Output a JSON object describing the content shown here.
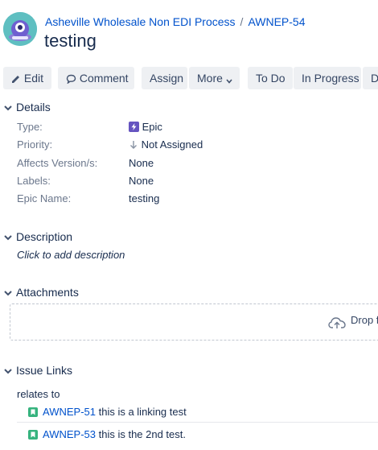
{
  "breadcrumb": {
    "project": "Asheville Wholesale Non EDI Process",
    "separator": "/",
    "issue_key": "AWNEP-54"
  },
  "title": "testing",
  "toolbar": {
    "edit": "Edit",
    "comment": "Comment",
    "assign": "Assign",
    "more": "More",
    "todo": "To Do",
    "in_progress": "In Progress",
    "done": "D"
  },
  "details": {
    "heading": "Details",
    "fields": [
      {
        "label": "Type:",
        "value": "Epic"
      },
      {
        "label": "Priority:",
        "value": "Not Assigned"
      },
      {
        "label": "Affects Version/s:",
        "value": "None"
      },
      {
        "label": "Labels:",
        "value": "None"
      },
      {
        "label": "Epic Name:",
        "value": "testing"
      }
    ]
  },
  "description": {
    "heading": "Description",
    "placeholder": "Click to add description"
  },
  "attachments": {
    "heading": "Attachments",
    "drop_text": "Drop f"
  },
  "issue_links": {
    "heading": "Issue Links",
    "relation": "relates to",
    "links": [
      {
        "key": "AWNEP-51",
        "summary": "this is a linking test"
      },
      {
        "key": "AWNEP-53",
        "summary": "this is the 2nd test."
      }
    ]
  },
  "colors": {
    "link": "#0052cc",
    "epic": "#6554c0",
    "story": "#36b37e",
    "avatar": "#5fbfc1"
  }
}
